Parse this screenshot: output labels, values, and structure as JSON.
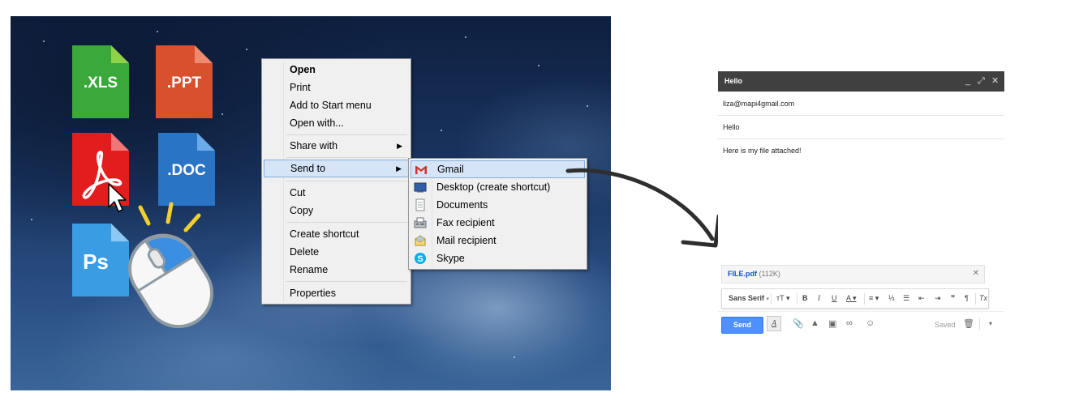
{
  "desktop": {
    "files": [
      {
        "label": ".XLS",
        "color": "#3aa83a",
        "fold": "#8fd24a"
      },
      {
        "label": ".PPT",
        "color": "#d9502f",
        "fold": "#ef8a6c"
      },
      {
        "label": "",
        "type": "pdf",
        "color": "#e31d1d",
        "fold": "#f27676"
      },
      {
        "label": ".DOC",
        "color": "#2a74c6",
        "fold": "#6aaae8"
      },
      {
        "label": "Ps",
        "color": "#3a9de3",
        "fold": "#8cc8f1"
      }
    ]
  },
  "context_menu": {
    "items": [
      "Open",
      "Print",
      "Add to Start menu",
      "Open with...",
      "Share with",
      "Send to",
      "Cut",
      "Copy",
      "Create shortcut",
      "Delete",
      "Rename",
      "Properties"
    ]
  },
  "send_to": {
    "items": [
      "Gmail",
      "Desktop (create shortcut)",
      "Documents",
      "Fax recipient",
      "Mail recipient",
      "Skype"
    ]
  },
  "compose": {
    "title": "Hello",
    "to": "liza@mapi4gmail.com",
    "subject": "Hello",
    "body": "Here is my file attached!",
    "attachment": {
      "name": "FILE.pdf",
      "size": "(112K)"
    },
    "font": "Sans Serif",
    "send_label": "Send",
    "saved_label": "Saved"
  },
  "colors": {
    "gmail_blue": "#4d90fe",
    "titlebar": "#404040",
    "menu_highlight": "#d5e5f7"
  }
}
